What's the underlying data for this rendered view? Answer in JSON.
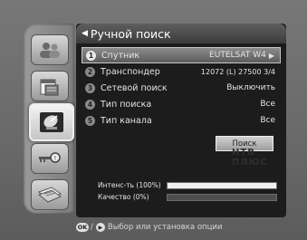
{
  "panel": {
    "title": "Ручной поиск",
    "menu": [
      {
        "num": "1",
        "label": "Спутник",
        "value": "EUTELSAT W4",
        "selected": true
      },
      {
        "num": "2",
        "label": "Транспондер",
        "value": "12072 (L) 27500 3/4"
      },
      {
        "num": "3",
        "label": "Сетевой поиск",
        "value": "Выключить"
      },
      {
        "num": "4",
        "label": "Тип поиска",
        "value": "Все"
      },
      {
        "num": "5",
        "label": "Тип канала",
        "value": "Все"
      }
    ],
    "search_button": "Поиск",
    "watermark": "НТВ ПЛЮС",
    "meters": [
      {
        "label": "Интенс-ть (100%)",
        "level": 1.0
      },
      {
        "label": "Качество (0%)",
        "level": 0
      }
    ]
  },
  "sidebar": {
    "items": [
      {
        "icon": "users-icon"
      },
      {
        "icon": "calendar-icon"
      },
      {
        "icon": "satellite-dish-icon",
        "active": true
      },
      {
        "icon": "key-search-icon"
      },
      {
        "icon": "newspaper-icon"
      }
    ]
  },
  "footer": {
    "ok_key": "OK",
    "separator": "/",
    "hint": "Выбор или установка опции"
  },
  "colors": {
    "background": "#6f6f6f",
    "panel": "#1c1c1c",
    "selected_row": "#8c8c8c",
    "meter_fill": "#f0f0f0"
  }
}
